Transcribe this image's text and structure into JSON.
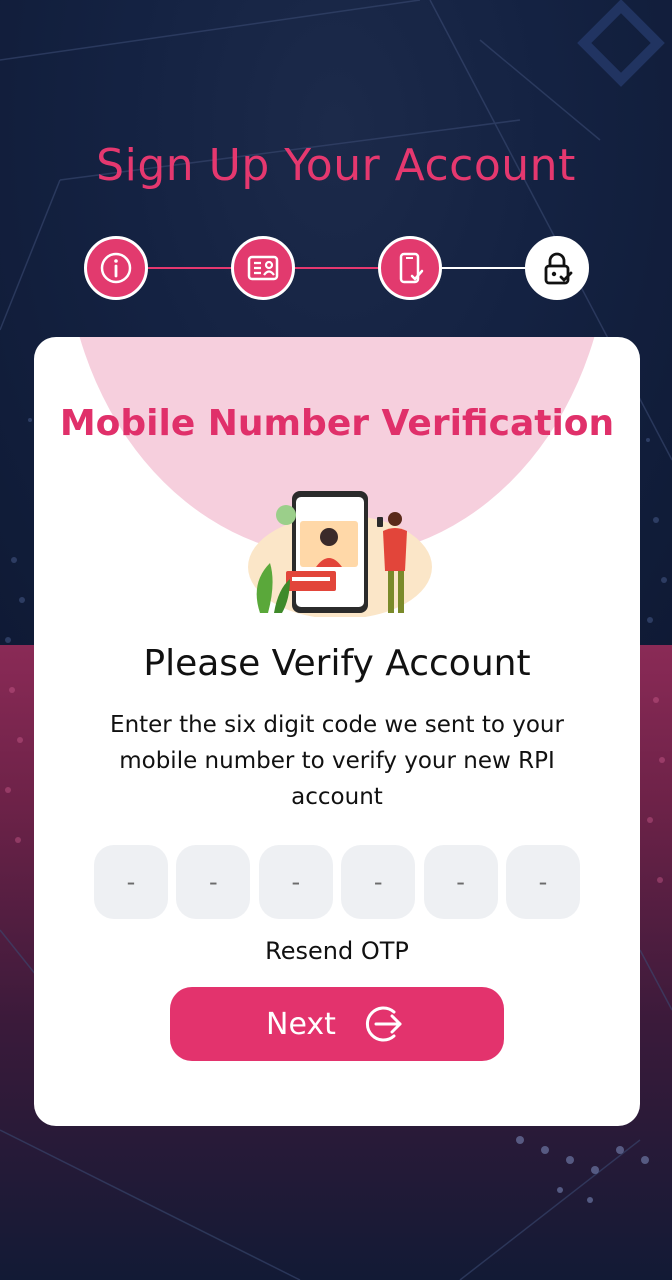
{
  "header": {
    "title": "Sign Up Your Account"
  },
  "stepper": {
    "steps": [
      {
        "icon": "info-icon",
        "state": "completed"
      },
      {
        "icon": "id-card-icon",
        "state": "completed"
      },
      {
        "icon": "mobile-check-icon",
        "state": "completed"
      },
      {
        "icon": "lock-check-icon",
        "state": "current"
      }
    ]
  },
  "card": {
    "heading": "Mobile Number Verification",
    "verify_title": "Please Verify Account",
    "description": "Enter the six digit code we sent to your mobile number to verify your new RPI account",
    "otp_boxes": [
      "-",
      "-",
      "-",
      "-",
      "-",
      "-"
    ],
    "resend_label": "Resend OTP",
    "next_label": "Next"
  },
  "colors": {
    "accent": "#e3336d",
    "card_blob": "#f6cfdd",
    "otp_bg": "#eef0f3",
    "bg_dark": "#111a33",
    "bg_pink": "#8a2a56"
  }
}
